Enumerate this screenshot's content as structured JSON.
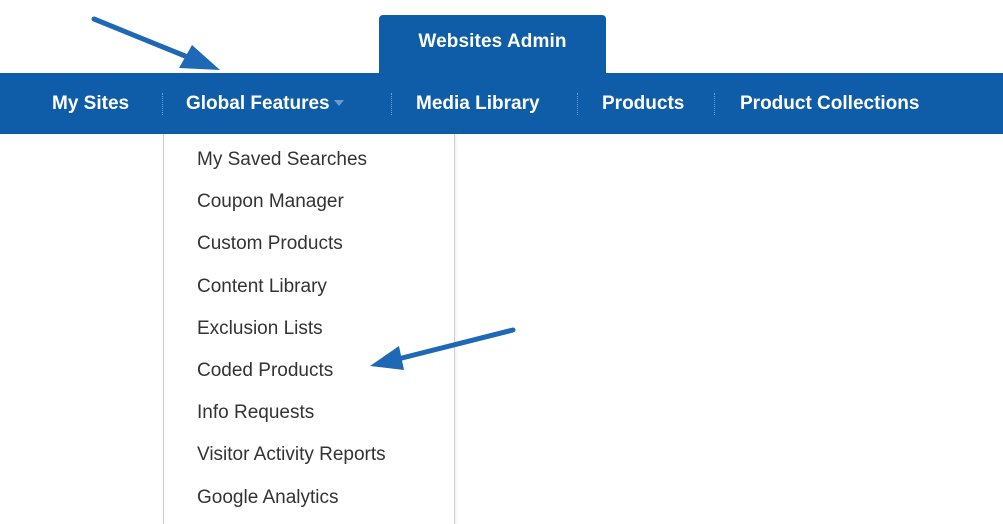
{
  "admin_tab": {
    "label": "Websites Admin"
  },
  "nav": {
    "items": [
      {
        "label": "My Sites"
      },
      {
        "label": "Global Features"
      },
      {
        "label": "Media Library"
      },
      {
        "label": "Products"
      },
      {
        "label": "Product Collections"
      }
    ]
  },
  "dropdown": {
    "items": [
      {
        "label": "My Saved Searches"
      },
      {
        "label": "Coupon Manager"
      },
      {
        "label": "Custom Products"
      },
      {
        "label": "Content Library"
      },
      {
        "label": "Exclusion Lists"
      },
      {
        "label": "Coded Products"
      },
      {
        "label": "Info Requests"
      },
      {
        "label": "Visitor Activity Reports"
      },
      {
        "label": "Google Analytics"
      }
    ]
  },
  "colors": {
    "nav_bg": "#0F5DA8",
    "nav_text": "#ffffff",
    "menu_text": "#333333",
    "annotation_arrow": "#1F68B5"
  },
  "annotations": [
    {
      "icon": "annotation-arrow-icon",
      "points_to": "Global Features"
    },
    {
      "icon": "annotation-arrow-icon",
      "points_to": "Coded Products"
    }
  ]
}
